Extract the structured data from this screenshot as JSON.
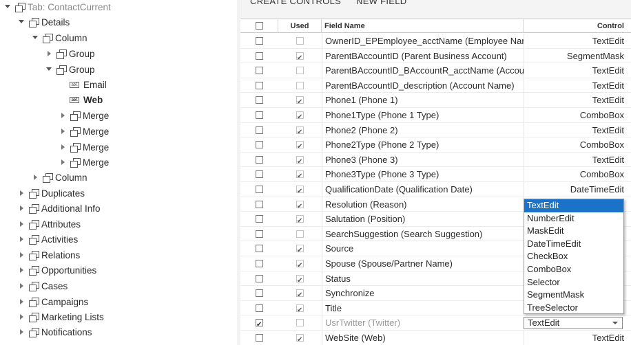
{
  "tree": {
    "items": [
      {
        "label": "Tab: ContactCurrent",
        "icon": "group-icon",
        "caret": "down",
        "dim": true
      },
      {
        "label": "Details",
        "icon": "group-icon",
        "caret": "down"
      },
      {
        "label": "Column",
        "icon": "group-icon",
        "caret": "down"
      },
      {
        "label": "Group",
        "icon": "group-icon",
        "caret": "right"
      },
      {
        "label": "Group",
        "icon": "group-icon",
        "caret": "down"
      },
      {
        "label": "Email",
        "icon": "field-icon",
        "caret": "none"
      },
      {
        "label": "Web",
        "icon": "field-icon",
        "caret": "none",
        "bold": true
      },
      {
        "label": "Merge",
        "icon": "group-icon",
        "caret": "right"
      },
      {
        "label": "Merge",
        "icon": "group-icon",
        "caret": "right"
      },
      {
        "label": "Merge",
        "icon": "group-icon",
        "caret": "right"
      },
      {
        "label": "Merge",
        "icon": "group-icon",
        "caret": "right"
      },
      {
        "label": "Column",
        "icon": "group-icon",
        "caret": "right"
      },
      {
        "label": "Duplicates",
        "icon": "group-icon",
        "caret": "right"
      },
      {
        "label": "Additional Info",
        "icon": "group-icon",
        "caret": "right"
      },
      {
        "label": "Attributes",
        "icon": "group-icon",
        "caret": "right"
      },
      {
        "label": "Activities",
        "icon": "group-icon",
        "caret": "right"
      },
      {
        "label": "Relations",
        "icon": "group-icon",
        "caret": "right"
      },
      {
        "label": "Opportunities",
        "icon": "group-icon",
        "caret": "right"
      },
      {
        "label": "Cases",
        "icon": "group-icon",
        "caret": "right"
      },
      {
        "label": "Campaigns",
        "icon": "group-icon",
        "caret": "right"
      },
      {
        "label": "Marketing Lists",
        "icon": "group-icon",
        "caret": "right"
      },
      {
        "label": "Notifications",
        "icon": "group-icon",
        "caret": "right"
      }
    ],
    "field_icon_text": "abl"
  },
  "toolbar": {
    "create_controls": "CREATE CONTROLS",
    "new_field": "NEW FIELD"
  },
  "grid": {
    "headers": {
      "used": "Used",
      "field_name": "Field Name",
      "control": "Control"
    },
    "rows": [
      {
        "field": "OwnerID_EPEmployee_acctName (Employee Nar",
        "control": "TextEdit",
        "selected": false,
        "used": false
      },
      {
        "field": "ParentBAccountID (Parent Business Account)",
        "control": "SegmentMask",
        "selected": false,
        "used": true
      },
      {
        "field": "ParentBAccountID_BAccountR_acctName (Accou",
        "control": "TextEdit",
        "selected": false,
        "used": false
      },
      {
        "field": "ParentBAccountID_description (Account Name)",
        "control": "TextEdit",
        "selected": false,
        "used": false
      },
      {
        "field": "Phone1 (Phone 1)",
        "control": "TextEdit",
        "selected": false,
        "used": true
      },
      {
        "field": "Phone1Type (Phone 1 Type)",
        "control": "ComboBox",
        "selected": false,
        "used": true
      },
      {
        "field": "Phone2 (Phone 2)",
        "control": "TextEdit",
        "selected": false,
        "used": true
      },
      {
        "field": "Phone2Type (Phone 2 Type)",
        "control": "ComboBox",
        "selected": false,
        "used": true
      },
      {
        "field": "Phone3 (Phone 3)",
        "control": "TextEdit",
        "selected": false,
        "used": true
      },
      {
        "field": "Phone3Type (Phone 3 Type)",
        "control": "ComboBox",
        "selected": false,
        "used": true
      },
      {
        "field": "QualificationDate (Qualification Date)",
        "control": "DateTimeEdit",
        "selected": false,
        "used": true
      },
      {
        "field": "Resolution (Reason)",
        "control": "",
        "selected": false,
        "used": true
      },
      {
        "field": "Salutation (Position)",
        "control": "",
        "selected": false,
        "used": true
      },
      {
        "field": "SearchSuggestion (Search Suggestion)",
        "control": "",
        "selected": false,
        "used": false
      },
      {
        "field": "Source",
        "control": "",
        "selected": false,
        "used": true
      },
      {
        "field": "Spouse (Spouse/Partner Name)",
        "control": "",
        "selected": false,
        "used": true
      },
      {
        "field": "Status",
        "control": "",
        "selected": false,
        "used": true
      },
      {
        "field": "Synchronize",
        "control": "",
        "selected": false,
        "used": true
      },
      {
        "field": "Title",
        "control": "",
        "selected": false,
        "used": true
      },
      {
        "field": "UsrTwitter (Twitter)",
        "control": "",
        "selected": true,
        "used": false,
        "dim": true,
        "editor": "TextEdit"
      },
      {
        "field": "WebSite (Web)",
        "control": "TextEdit",
        "selected": false,
        "used": true
      }
    ]
  },
  "dropdown": {
    "options": [
      "TextEdit",
      "NumberEdit",
      "MaskEdit",
      "DateTimeEdit",
      "CheckBox",
      "ComboBox",
      "Selector",
      "SegmentMask",
      "TreeSelector"
    ],
    "active": "TextEdit"
  }
}
